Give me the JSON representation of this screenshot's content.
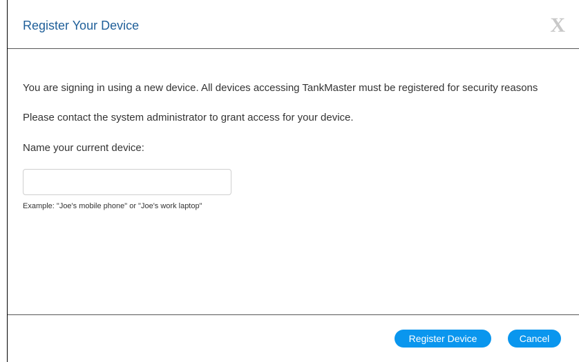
{
  "dialog": {
    "title": "Register Your Device",
    "close_label": "X"
  },
  "body": {
    "message_new_device": "You are signing in using a new device. All devices accessing TankMaster must be registered for security reasons",
    "message_contact_admin": "Please contact the system administrator to grant access for your device.",
    "name_label": "Name your current device:",
    "device_name_value": "",
    "device_name_placeholder": "",
    "hint": "Example: \"Joe's mobile phone\" or \"Joe's work laptop\""
  },
  "footer": {
    "register_label": "Register Device",
    "cancel_label": "Cancel"
  },
  "colors": {
    "title": "#1f5f99",
    "button": "#0a96ee",
    "close_icon": "#c8c8c8"
  }
}
